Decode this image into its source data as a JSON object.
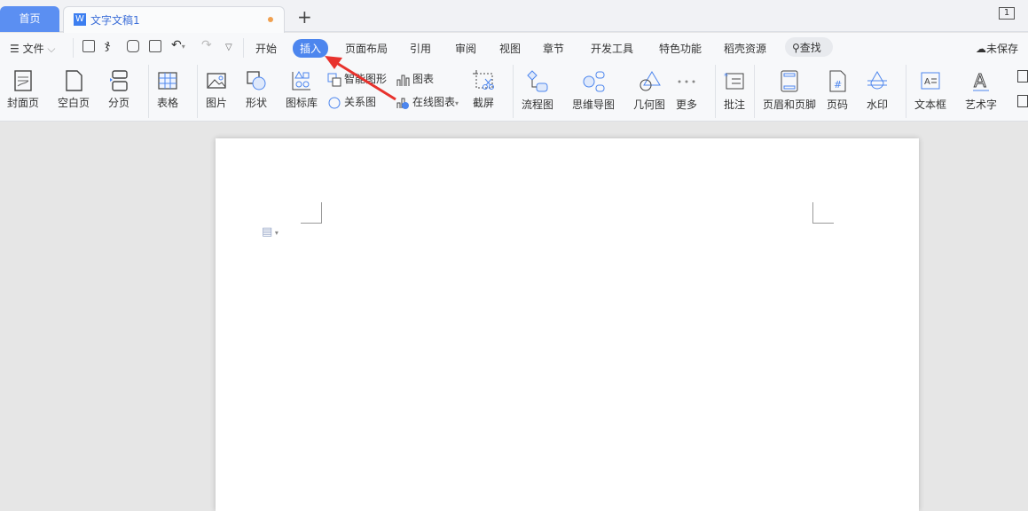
{
  "tabs": {
    "home": "首页",
    "doc": "文字文稿1",
    "doc_icon": "W",
    "new": "+",
    "page_indicator": "1"
  },
  "menu": {
    "file": "文件",
    "items": [
      "开始",
      "插入",
      "页面布局",
      "引用",
      "审阅",
      "视图",
      "章节",
      "开发工具",
      "特色功能",
      "稻壳资源"
    ],
    "search": "查找",
    "unsaved": "未保存"
  },
  "ribbon": {
    "cover": "封面页",
    "blank": "空白页",
    "break": "分页",
    "table": "表格",
    "picture": "图片",
    "shape": "形状",
    "iconlib": "图标库",
    "smartart": "智能图形",
    "chart": "图表",
    "relation": "关系图",
    "online_chart": "在线图表",
    "screenshot": "截屏",
    "flowchart": "流程图",
    "mindmap": "思维导图",
    "geometry": "几何图",
    "more": "更多",
    "comment": "批注",
    "header_footer": "页眉和页脚",
    "page_number": "页码",
    "watermark": "水印",
    "textbox": "文本框",
    "wordart": "艺术字"
  },
  "colors": {
    "accent": "#4d86ee",
    "arrow": "#e8322d"
  }
}
